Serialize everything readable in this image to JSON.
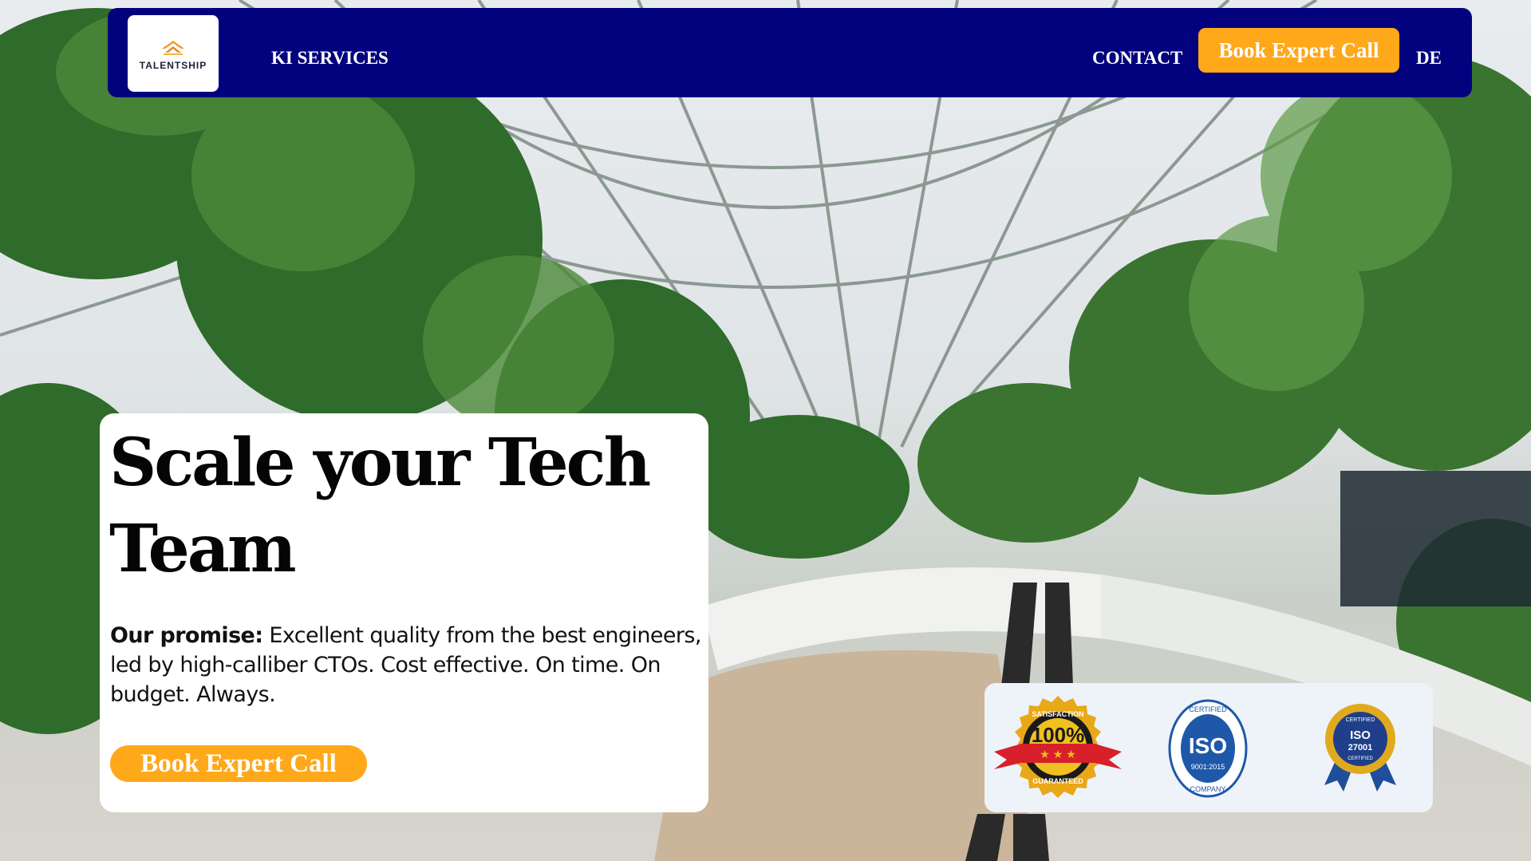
{
  "nav": {
    "logo_text": "TALENTSHIP",
    "services_label": "KI SERVICES",
    "contact_label": "CONTACT",
    "cta_label": "Book Expert Call",
    "lang_label": "DE"
  },
  "hero": {
    "title": "Scale your Tech Team",
    "promise_label": "Our promise:",
    "promise_text": " Excellent quality from the best engineers, led by high-calliber CTOs. Cost effective. On time. On budget. Always.",
    "cta_label": "Book Expert Call"
  },
  "badges": {
    "satisfaction": {
      "top": "SATISFACTION",
      "value": "100%",
      "bottom": "GUARANTEED"
    },
    "iso9001": {
      "top": "CERTIFIED",
      "value": "ISO",
      "standard": "9001:2015",
      "bottom": "COMPANY"
    },
    "iso27001": {
      "top": "CERTIFIED",
      "value": "ISO",
      "standard": "27001",
      "bottom": "CERTIFIED"
    }
  },
  "colors": {
    "nav_bg": "#02027e",
    "accent": "#ffa81a",
    "card_bg": "#ffffff",
    "badge_panel_bg": "#eef3fa"
  },
  "icons": [
    "logo-icon",
    "satisfaction-badge-icon",
    "iso-9001-badge-icon",
    "iso-27001-badge-icon"
  ]
}
